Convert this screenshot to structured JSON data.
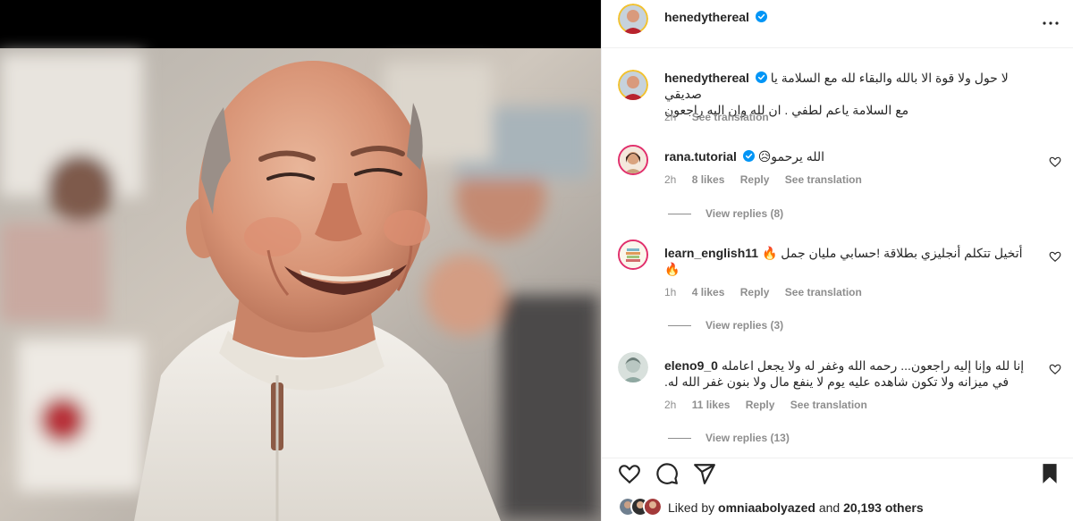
{
  "post": {
    "author": "henedythereal",
    "author_verified": true,
    "caption_line1": "لا حول ولا قوة الا بالله والبقاء لله مع السلامة يا صديقي",
    "caption_line2": "مع السلامة ياعم لطفي . ان لله وان اليه راجعون",
    "caption_time": "2h",
    "see_translation": "See translation"
  },
  "comments": [
    {
      "username": "rana.tutorial",
      "verified": true,
      "text": "الله يرحمو😥",
      "time": "2h",
      "likes": "8 likes",
      "reply": "Reply",
      "see_translation": "See translation",
      "view_replies": "View replies (8)",
      "avatar_icon": "profile-avatar"
    },
    {
      "username": "learn_english11",
      "verified": false,
      "text": "أتخيل تتكلم أنجليزي بطلاقة !حسابي مليان جمل 🔥",
      "text_line2": "🔥",
      "time": "1h",
      "likes": "4 likes",
      "reply": "Reply",
      "see_translation": "See translation",
      "view_replies": "View replies (3)",
      "avatar_icon": "books-avatar"
    },
    {
      "username": "eleno9_0",
      "verified": false,
      "text": "إنا لله وإنا إليه راجعون... رحمه الله وغفر له ولا يجعل اعامله",
      "text_line2": "في ميزانه ولا تكون شاهده عليه يوم لا ينفع مال ولا بنون غفر الله له.",
      "time": "2h",
      "likes": "11 likes",
      "reply": "Reply",
      "see_translation": "See translation",
      "view_replies": "View replies (13)",
      "avatar_icon": "profile-avatar"
    }
  ],
  "likes_summary": {
    "prefix": "Liked by",
    "user": "omniaabolyazed",
    "middle": "and",
    "count": "20,193 others"
  },
  "icons": {
    "more": "more-horizontal-icon",
    "like": "heart-icon",
    "comment": "comment-icon",
    "share": "share-icon",
    "save": "bookmark-icon",
    "verified": "verified-badge-icon"
  },
  "colors": {
    "verified": "#0095f6",
    "muted": "#8e8e8e",
    "text": "#262626",
    "border": "#efefef"
  }
}
